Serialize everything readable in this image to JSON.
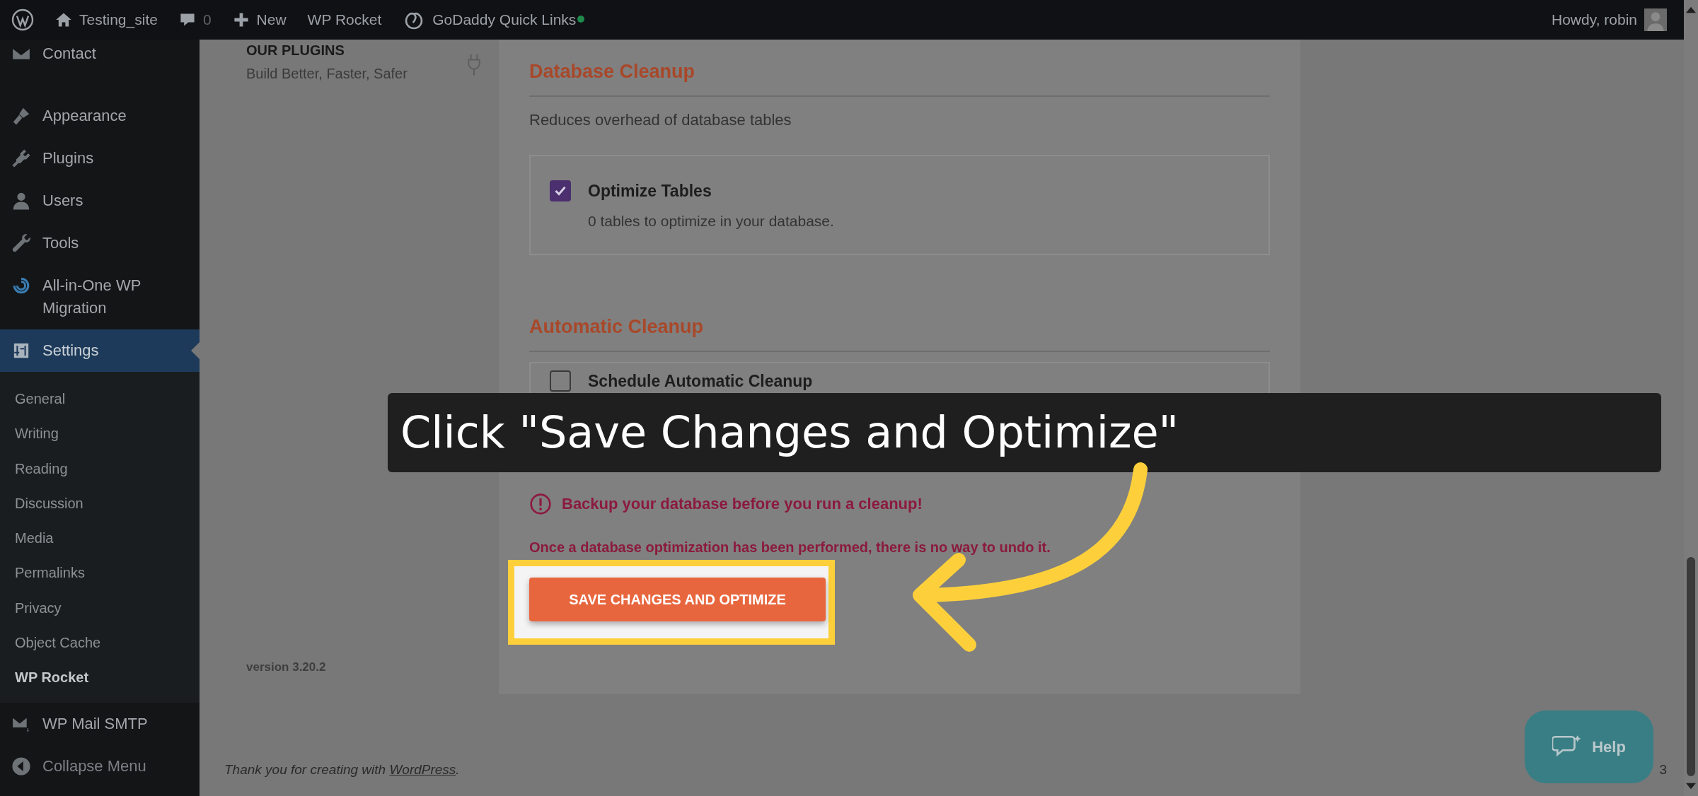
{
  "admin_bar": {
    "site_name": "Testing_site",
    "comments_count": "0",
    "new_label": "New",
    "items": [
      "WP Rocket",
      "GoDaddy Quick Links"
    ],
    "greeting": "Howdy, robin"
  },
  "sidebar": {
    "items": [
      {
        "label": "Contact",
        "selected": false
      },
      {
        "label": "Appearance",
        "selected": false
      },
      {
        "label": "Plugins",
        "selected": false
      },
      {
        "label": "Users",
        "selected": false
      },
      {
        "label": "Tools",
        "selected": false
      },
      {
        "label": "All-in-One WP Migration",
        "selected": false
      },
      {
        "label": "Settings",
        "selected": true,
        "children": [
          {
            "label": "General",
            "selected": false
          },
          {
            "label": "Writing",
            "selected": false
          },
          {
            "label": "Reading",
            "selected": false
          },
          {
            "label": "Discussion",
            "selected": false
          },
          {
            "label": "Media",
            "selected": false
          },
          {
            "label": "Permalinks",
            "selected": false
          },
          {
            "label": "Privacy",
            "selected": false
          },
          {
            "label": "Object Cache",
            "selected": false
          },
          {
            "label": "WP Rocket",
            "selected": true
          }
        ]
      },
      {
        "label": "WP Mail SMTP",
        "selected": false
      },
      {
        "label": "Collapse Menu",
        "selected": false
      }
    ]
  },
  "plugins_promo": {
    "title": "OUR PLUGINS",
    "subtitle": "Build Better, Faster, Safer"
  },
  "version": "version 3.20.2",
  "sections": [
    {
      "title": "Database Cleanup",
      "description": "Reduces overhead of database tables",
      "options": [
        {
          "label": "Optimize Tables",
          "detail": "0 tables to optimize in your database.",
          "checked": true
        }
      ]
    },
    {
      "title": "Automatic Cleanup",
      "options": [
        {
          "label": "Schedule Automatic Cleanup",
          "checked": false
        }
      ]
    }
  ],
  "warning": "Backup your database before you run a cleanup!",
  "notice": "Once a database optimization has been performed, there is no way to undo it.",
  "primary_button": "SAVE CHANGES AND OPTIMIZE",
  "footer": {
    "text_before": "Thank you for creating with ",
    "link": "WordPress",
    "text_after": "."
  },
  "version_fragment": "3",
  "help_button": "Help",
  "tutorial": {
    "caption": "Click \"Save Changes and Optimize\""
  }
}
